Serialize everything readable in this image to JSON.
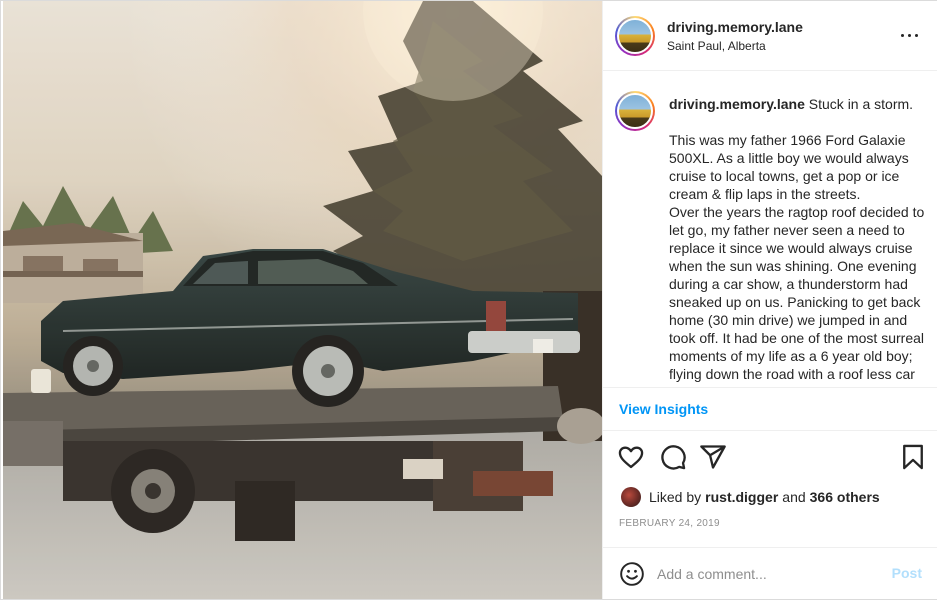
{
  "post": {
    "username": "driving.memory.lane",
    "location": "Saint Paul, Alberta",
    "caption": {
      "username": "driving.memory.lane",
      "first_line": "Stuck in a storm.",
      "paragraph_1": "This was my father 1966 Ford Galaxie 500XL. As a little boy we would always cruise to local towns, get a pop or ice cream & flip laps in the streets.",
      "paragraph_2": "Over the years the ragtop roof decided to let go, my father never seen a need to replace it since we would always cruise when the sun was shining. One evening during a car show, a thunderstorm had sneaked up on us. Panicking to get back home (30 min drive) we jumped in and took off. It had be one of the most surreal moments of my life as a 6 year old boy; flying down the road with a roof less car in a"
    },
    "view_insights": "View Insights",
    "likes": {
      "prefix": "Liked by",
      "user": "rust.digger",
      "connector": "and",
      "others": "366 others"
    },
    "date": "FEBRUARY 24, 2019",
    "comment": {
      "placeholder": "Add a comment...",
      "post_label": "Post"
    },
    "icons": {
      "more": "more-options-icon",
      "like": "heart-icon",
      "comment": "comment-icon",
      "share": "share-icon",
      "save": "bookmark-icon",
      "emoji": "emoji-icon"
    },
    "colors": {
      "accent": "#0095f6",
      "post_disabled": "#b2dffc",
      "muted": "#8e8e8e"
    }
  }
}
